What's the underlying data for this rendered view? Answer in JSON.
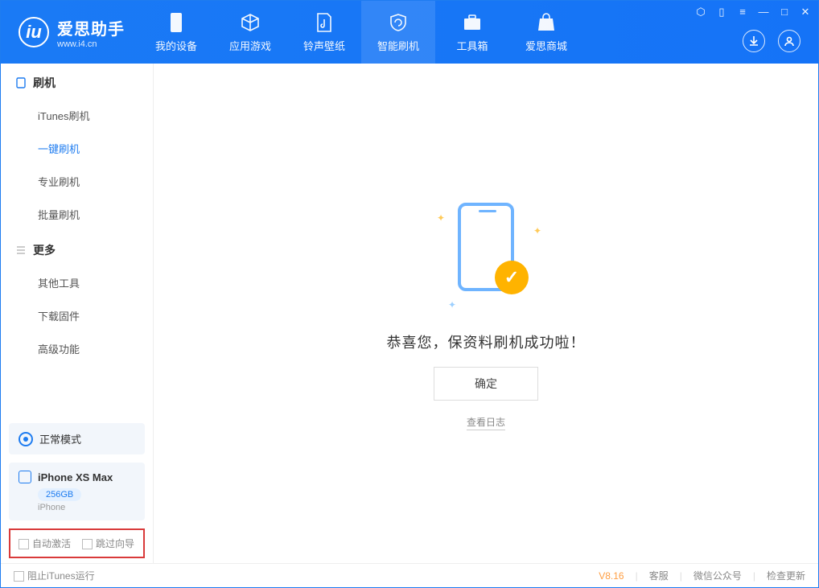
{
  "brand": {
    "name": "爱思助手",
    "url": "www.i4.cn"
  },
  "tabs": [
    {
      "key": "device",
      "label": "我的设备"
    },
    {
      "key": "apps",
      "label": "应用游戏"
    },
    {
      "key": "media",
      "label": "铃声壁纸"
    },
    {
      "key": "flash",
      "label": "智能刷机"
    },
    {
      "key": "toolbox",
      "label": "工具箱"
    },
    {
      "key": "store",
      "label": "爱思商城"
    }
  ],
  "activeTab": "flash",
  "sidebar": {
    "section_flash": {
      "title": "刷机",
      "items": [
        "iTunes刷机",
        "一键刷机",
        "专业刷机",
        "批量刷机"
      ],
      "activeIndex": 1
    },
    "section_more": {
      "title": "更多",
      "items": [
        "其他工具",
        "下载固件",
        "高级功能"
      ]
    }
  },
  "mode": {
    "label": "正常模式"
  },
  "device": {
    "name": "iPhone XS Max",
    "storage": "256GB",
    "type": "iPhone"
  },
  "options": {
    "auto_activate": "自动激活",
    "skip_guide": "跳过向导"
  },
  "main": {
    "success_text": "恭喜您，保资料刷机成功啦！",
    "ok_button": "确定",
    "view_log": "查看日志"
  },
  "footer": {
    "prevent_itunes": "阻止iTunes运行",
    "version": "V8.16",
    "links": {
      "service": "客服",
      "wechat": "微信公众号",
      "update": "检查更新"
    }
  }
}
